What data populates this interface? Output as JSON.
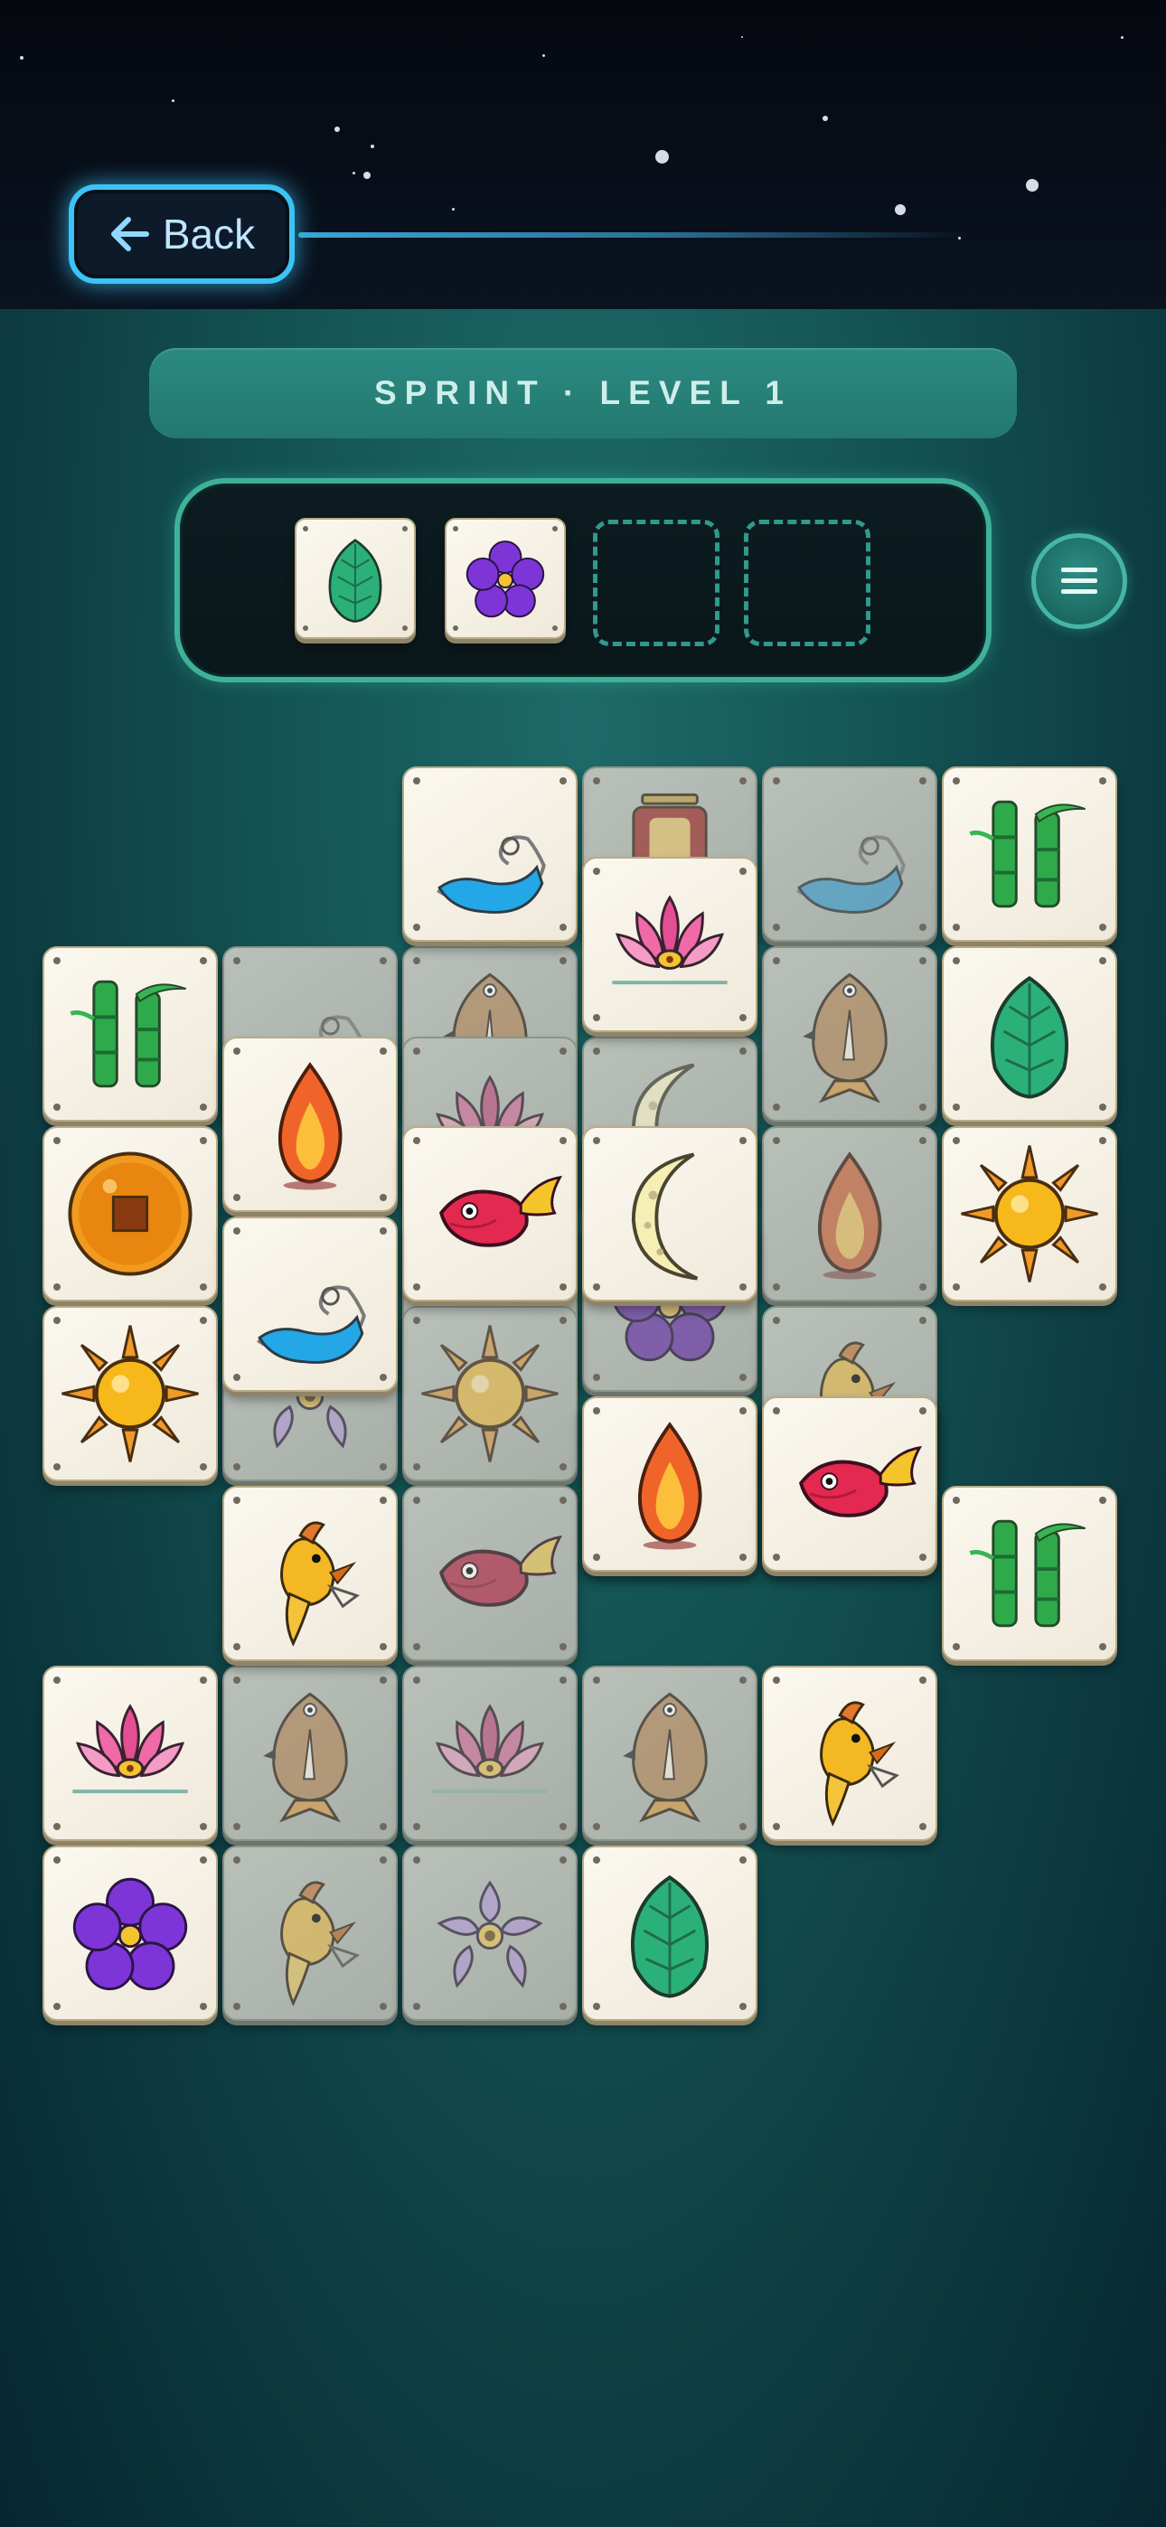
{
  "header": {
    "back_label": "Back",
    "back_icon": "arrow-left-icon"
  },
  "level": {
    "title": "SPRINT · LEVEL 1"
  },
  "tray": {
    "capacity": 4,
    "filled": [
      "leaf",
      "violet-flower"
    ]
  },
  "menu": {
    "icon": "hamburger-menu-icon"
  },
  "colors": {
    "accent": "#3cc3f5",
    "tray_border": "#3fb09a",
    "banner": "#2b8a82",
    "tile_face": "#f7f3e8"
  },
  "tiles": [
    {
      "symbol": "wave",
      "row": 0,
      "col": 2,
      "state": "free"
    },
    {
      "symbol": "lantern",
      "row": 0,
      "col": 3,
      "state": "blocked"
    },
    {
      "symbol": "wave",
      "row": 0,
      "col": 4,
      "state": "blocked"
    },
    {
      "symbol": "bamboo",
      "row": 0,
      "col": 5,
      "state": "free"
    },
    {
      "symbol": "lotus",
      "row": 0.5,
      "col": 3,
      "state": "free"
    },
    {
      "symbol": "bamboo",
      "row": 1,
      "col": 0,
      "state": "free"
    },
    {
      "symbol": "wave",
      "row": 1,
      "col": 1,
      "state": "blocked"
    },
    {
      "symbol": "bird",
      "row": 1,
      "col": 2,
      "state": "blocked"
    },
    {
      "symbol": "bird",
      "row": 1,
      "col": 4,
      "state": "blocked"
    },
    {
      "symbol": "leaf",
      "row": 1,
      "col": 5,
      "state": "free"
    },
    {
      "symbol": "lotus",
      "row": 1.5,
      "col": 2,
      "state": "blocked"
    },
    {
      "symbol": "moon",
      "row": 1.5,
      "col": 3,
      "state": "blocked"
    },
    {
      "symbol": "flame",
      "row": 1.5,
      "col": 1,
      "state": "free"
    },
    {
      "symbol": "coin",
      "row": 2,
      "col": 0,
      "state": "free"
    },
    {
      "symbol": "flame",
      "row": 2,
      "col": 4,
      "state": "blocked"
    },
    {
      "symbol": "sun",
      "row": 2,
      "col": 5,
      "state": "free"
    },
    {
      "symbol": "violet-flower",
      "row": 2.5,
      "col": 3,
      "state": "blocked"
    },
    {
      "symbol": "lantern",
      "row": 2.5,
      "col": 2,
      "state": "blocked"
    },
    {
      "symbol": "goldfish",
      "row": 2,
      "col": 2,
      "state": "free"
    },
    {
      "symbol": "moon",
      "row": 2,
      "col": 3,
      "state": "free"
    },
    {
      "symbol": "sun",
      "row": 3,
      "col": 0,
      "state": "free"
    },
    {
      "symbol": "lilac-flower",
      "row": 3,
      "col": 1,
      "state": "blocked"
    },
    {
      "symbol": "sun",
      "row": 3,
      "col": 2,
      "state": "blocked"
    },
    {
      "symbol": "canary",
      "row": 3,
      "col": 4,
      "state": "blocked"
    },
    {
      "symbol": "wave",
      "row": 2.5,
      "col": 1,
      "state": "free"
    },
    {
      "symbol": "bamboo",
      "row": 3.5,
      "col": 3,
      "state": "blocked"
    },
    {
      "symbol": "goldfish",
      "row": 3.5,
      "col": 4,
      "state": "blocked"
    },
    {
      "symbol": "flame",
      "row": 3.5,
      "col": 3,
      "state": "free"
    },
    {
      "symbol": "goldfish",
      "row": 3.5,
      "col": 4,
      "state": "free"
    },
    {
      "symbol": "canary",
      "row": 4,
      "col": 1,
      "state": "free"
    },
    {
      "symbol": "goldfish",
      "row": 4,
      "col": 2,
      "state": "blocked"
    },
    {
      "symbol": "bamboo",
      "row": 4,
      "col": 5,
      "state": "free"
    },
    {
      "symbol": "lotus",
      "row": 5,
      "col": 0,
      "state": "free"
    },
    {
      "symbol": "bird",
      "row": 5,
      "col": 1,
      "state": "blocked"
    },
    {
      "symbol": "lotus",
      "row": 5,
      "col": 2,
      "state": "blocked"
    },
    {
      "symbol": "bird",
      "row": 5,
      "col": 3,
      "state": "blocked"
    },
    {
      "symbol": "canary",
      "row": 5,
      "col": 4,
      "state": "free"
    },
    {
      "symbol": "violet-flower",
      "row": 6,
      "col": 0,
      "state": "free"
    },
    {
      "symbol": "canary",
      "row": 6,
      "col": 1,
      "state": "blocked"
    },
    {
      "symbol": "lilac-flower",
      "row": 6,
      "col": 2,
      "state": "blocked"
    },
    {
      "symbol": "leaf",
      "row": 6,
      "col": 3,
      "state": "free"
    }
  ]
}
